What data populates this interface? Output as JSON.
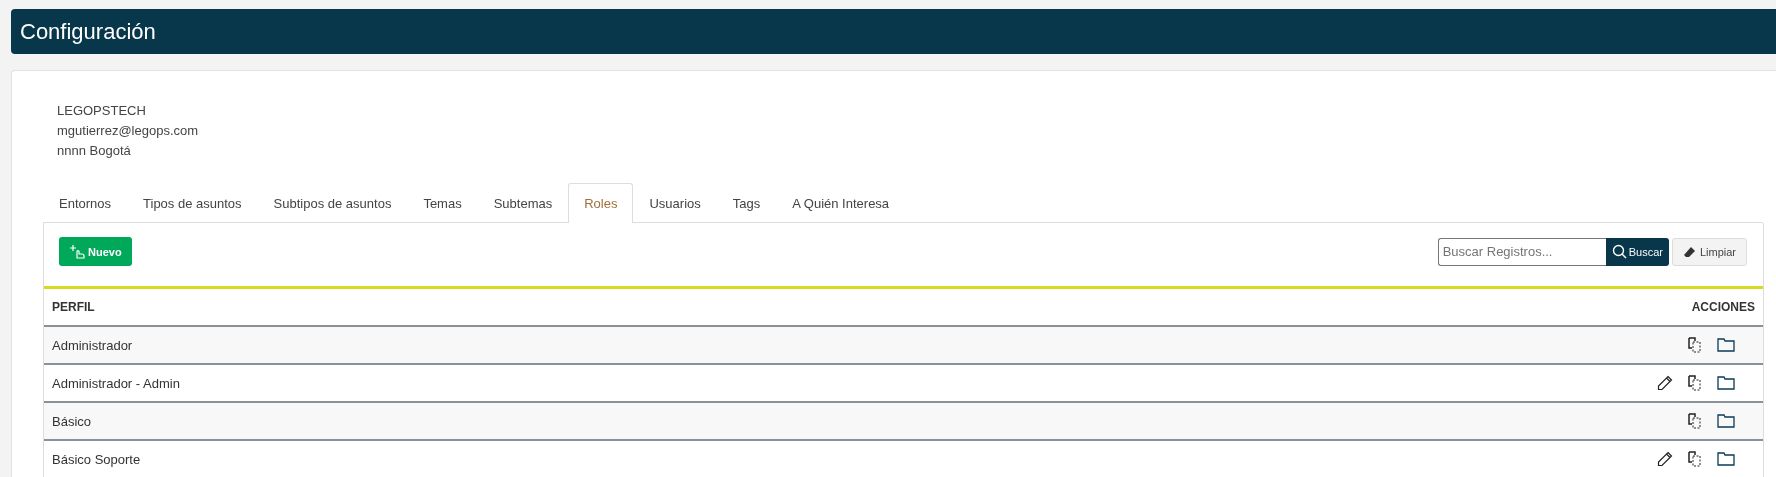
{
  "header": {
    "title": "Configuración"
  },
  "account": {
    "lines": [
      "LEGOPSTECH",
      "mgutierrez@legops.com",
      "nnnn Bogotá"
    ]
  },
  "tabs": [
    {
      "label": "Entornos",
      "selected": false
    },
    {
      "label": "Tipos de asuntos",
      "selected": false
    },
    {
      "label": "Subtipos de asuntos",
      "selected": false
    },
    {
      "label": "Temas",
      "selected": false
    },
    {
      "label": "Subtemas",
      "selected": false
    },
    {
      "label": "Roles",
      "selected": true
    },
    {
      "label": "Usuarios",
      "selected": false
    },
    {
      "label": "Tags",
      "selected": false
    },
    {
      "label": "A Quién Interesa",
      "selected": false
    }
  ],
  "toolbar": {
    "new_button": "Nuevo",
    "search": {
      "placeholder": "Buscar Registros..."
    },
    "search_button": "Buscar",
    "clear_button": "Limpiar"
  },
  "table": {
    "columns": [
      "PERFIL",
      "ACCIONES"
    ],
    "rows": [
      {
        "perfil": "Administrador",
        "actions": [
          {
            "kind": "copy"
          },
          {
            "kind": "folder"
          }
        ]
      },
      {
        "perfil": "Administrador - Admin",
        "actions": [
          {
            "kind": "edit"
          },
          {
            "kind": "copy"
          },
          {
            "kind": "folder"
          }
        ]
      },
      {
        "perfil": "Básico",
        "actions": [
          {
            "kind": "copy"
          },
          {
            "kind": "folder"
          }
        ]
      },
      {
        "perfil": "Básico Soporte",
        "actions": [
          {
            "kind": "edit"
          },
          {
            "kind": "copy"
          },
          {
            "kind": "folder"
          }
        ]
      }
    ]
  }
}
